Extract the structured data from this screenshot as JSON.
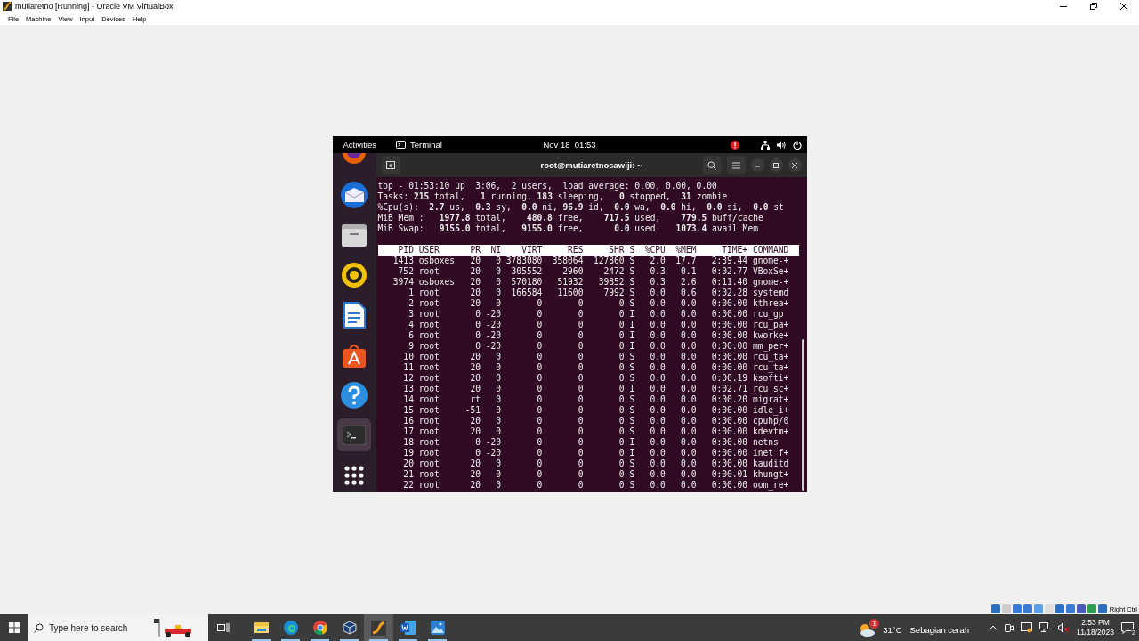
{
  "window": {
    "title": "mutiaretno [Running] - Oracle VM VirtualBox"
  },
  "menu": [
    "File",
    "Machine",
    "View",
    "Input",
    "Devices",
    "Help"
  ],
  "guest": {
    "top_bar": {
      "activities": "Activities",
      "app": "Terminal",
      "clock": "Nov 18  01:53"
    },
    "dock": [
      {
        "kind": "firefox",
        "active": false
      },
      {
        "kind": "thunderbird",
        "active": false
      },
      {
        "kind": "files",
        "active": false
      },
      {
        "kind": "rhythmbox",
        "active": false
      },
      {
        "kind": "writer",
        "active": false
      },
      {
        "kind": "software",
        "active": false
      },
      {
        "kind": "help",
        "active": false
      },
      {
        "kind": "terminal",
        "active": true
      },
      {
        "kind": "apps",
        "active": false
      }
    ],
    "terminal": {
      "title": "root@mutiaretnosawiji: ~",
      "summary": [
        "top - 01:53:10 up  3:06,  2 users,  load average: 0.00, 0.00, 0.00",
        "Tasks: **215** total,   **1** running, **183** sleeping,   **0** stopped,  **31** zombie",
        "%Cpu(s):  **2.7** us,  **0.3** sy,  **0.0** ni, **96.9** id,  **0.0** wa,  **0.0** hi,  **0.0** si,  **0.0** st",
        "MiB Mem :   **1977.8** total,    **480.8** free,    **717.5** used,    **779.5** buff/cache",
        "MiB Swap:   **9155.0** total,   **9155.0** free,      **0.0** used.   **1073.4** avail Mem"
      ],
      "columns": [
        "PID",
        "USER",
        "PR",
        "NI",
        "VIRT",
        "RES",
        "SHR",
        "S",
        "%CPU",
        "%MEM",
        "TIME+",
        "COMMAND"
      ],
      "rows": [
        [
          "1413",
          "osboxes",
          "20",
          "0",
          "3783080",
          "358064",
          "127860",
          "S",
          "2.0",
          "17.7",
          "2:39.44",
          "gnome-+"
        ],
        [
          "752",
          "root",
          "20",
          "0",
          "305552",
          "2960",
          "2472",
          "S",
          "0.3",
          "0.1",
          "0:02.77",
          "VBoxSe+"
        ],
        [
          "3974",
          "osboxes",
          "20",
          "0",
          "570180",
          "51932",
          "39852",
          "S",
          "0.3",
          "2.6",
          "0:11.40",
          "gnome-+"
        ],
        [
          "1",
          "root",
          "20",
          "0",
          "166584",
          "11600",
          "7992",
          "S",
          "0.0",
          "0.6",
          "0:02.28",
          "systemd"
        ],
        [
          "2",
          "root",
          "20",
          "0",
          "0",
          "0",
          "0",
          "S",
          "0.0",
          "0.0",
          "0:00.00",
          "kthrea+"
        ],
        [
          "3",
          "root",
          "0",
          "-20",
          "0",
          "0",
          "0",
          "I",
          "0.0",
          "0.0",
          "0:00.00",
          "rcu_gp"
        ],
        [
          "4",
          "root",
          "0",
          "-20",
          "0",
          "0",
          "0",
          "I",
          "0.0",
          "0.0",
          "0:00.00",
          "rcu_pa+"
        ],
        [
          "6",
          "root",
          "0",
          "-20",
          "0",
          "0",
          "0",
          "I",
          "0.0",
          "0.0",
          "0:00.00",
          "kworke+"
        ],
        [
          "9",
          "root",
          "0",
          "-20",
          "0",
          "0",
          "0",
          "I",
          "0.0",
          "0.0",
          "0:00.00",
          "mm_per+"
        ],
        [
          "10",
          "root",
          "20",
          "0",
          "0",
          "0",
          "0",
          "S",
          "0.0",
          "0.0",
          "0:00.00",
          "rcu_ta+"
        ],
        [
          "11",
          "root",
          "20",
          "0",
          "0",
          "0",
          "0",
          "S",
          "0.0",
          "0.0",
          "0:00.00",
          "rcu_ta+"
        ],
        [
          "12",
          "root",
          "20",
          "0",
          "0",
          "0",
          "0",
          "S",
          "0.0",
          "0.0",
          "0:00.19",
          "ksofti+"
        ],
        [
          "13",
          "root",
          "20",
          "0",
          "0",
          "0",
          "0",
          "I",
          "0.0",
          "0.0",
          "0:02.71",
          "rcu_sc+"
        ],
        [
          "14",
          "root",
          "rt",
          "0",
          "0",
          "0",
          "0",
          "S",
          "0.0",
          "0.0",
          "0:00.20",
          "migrat+"
        ],
        [
          "15",
          "root",
          "-51",
          "0",
          "0",
          "0",
          "0",
          "S",
          "0.0",
          "0.0",
          "0:00.00",
          "idle_i+"
        ],
        [
          "16",
          "root",
          "20",
          "0",
          "0",
          "0",
          "0",
          "S",
          "0.0",
          "0.0",
          "0:00.00",
          "cpuhp/0"
        ],
        [
          "17",
          "root",
          "20",
          "0",
          "0",
          "0",
          "0",
          "S",
          "0.0",
          "0.0",
          "0:00.00",
          "kdevtm+"
        ],
        [
          "18",
          "root",
          "0",
          "-20",
          "0",
          "0",
          "0",
          "I",
          "0.0",
          "0.0",
          "0:00.00",
          "netns"
        ],
        [
          "19",
          "root",
          "0",
          "-20",
          "0",
          "0",
          "0",
          "I",
          "0.0",
          "0.0",
          "0:00.00",
          "inet_f+"
        ],
        [
          "20",
          "root",
          "20",
          "0",
          "0",
          "0",
          "0",
          "S",
          "0.0",
          "0.0",
          "0:00.00",
          "kauditd"
        ],
        [
          "21",
          "root",
          "20",
          "0",
          "0",
          "0",
          "0",
          "S",
          "0.0",
          "0.0",
          "0:00.01",
          "khungt+"
        ],
        [
          "22",
          "root",
          "20",
          "0",
          "0",
          "0",
          "0",
          "S",
          "0.0",
          "0.0",
          "0:00.00",
          "oom_re+"
        ]
      ]
    }
  },
  "status_bar": {
    "host_key": "Right Ctrl"
  },
  "taskbar": {
    "search_placeholder": "Type here to search",
    "apps": [
      {
        "kind": "explorer",
        "active": false
      },
      {
        "kind": "edge",
        "active": false
      },
      {
        "kind": "chrome",
        "active": false
      },
      {
        "kind": "virtualbox",
        "active": false
      },
      {
        "kind": "vm",
        "active": true
      },
      {
        "kind": "word",
        "active": false
      },
      {
        "kind": "photos",
        "active": false
      }
    ],
    "weather": {
      "badge": "1",
      "temperature": "31°C",
      "condition": "Sebagian cerah"
    },
    "time": "2:53 PM",
    "date": "11/18/2023",
    "notifications": "2"
  }
}
